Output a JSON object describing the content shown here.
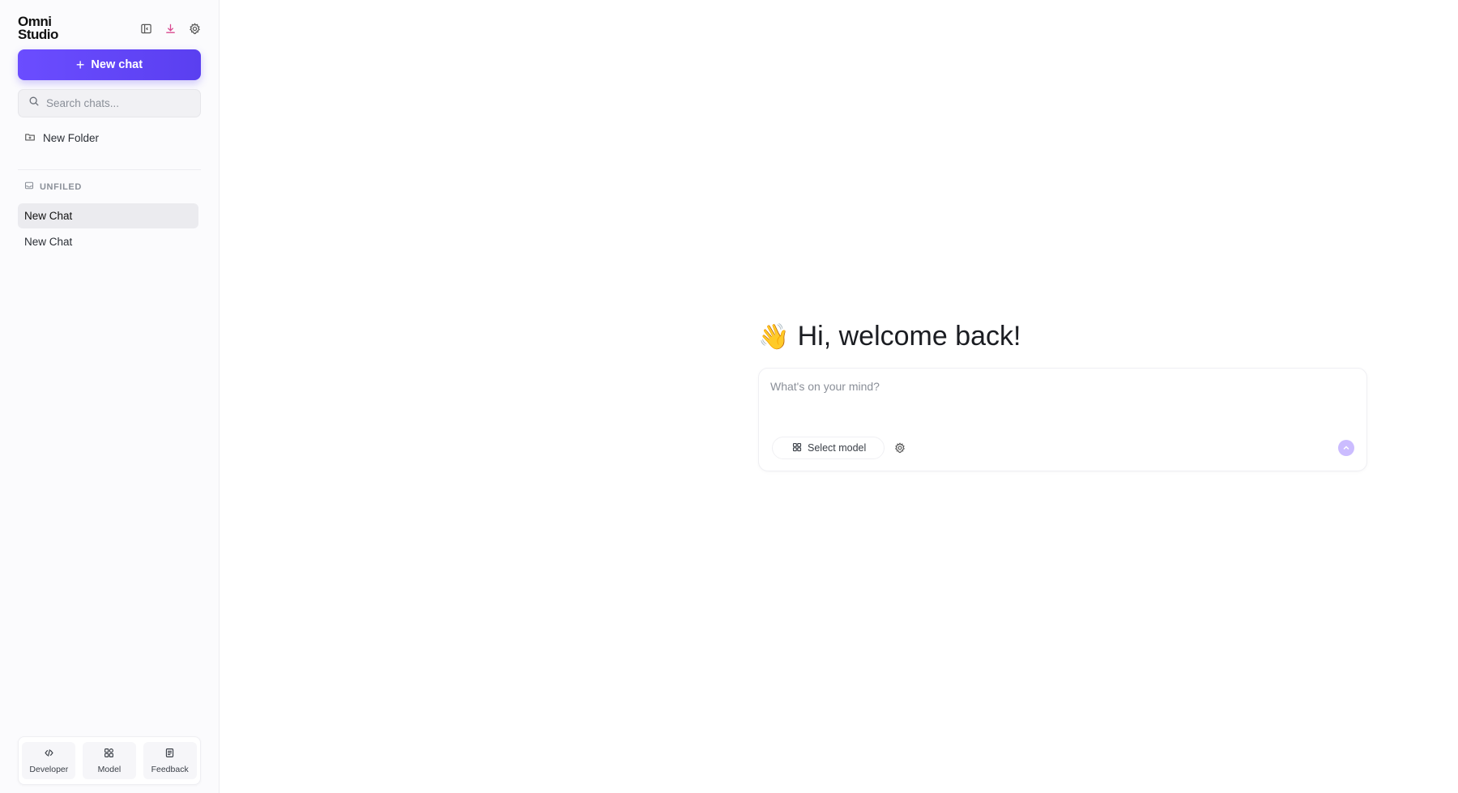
{
  "sidebar": {
    "logo_line1": "Omni",
    "logo_line2": "Studio",
    "header_icons": [
      "sidebar-toggle-icon",
      "download-icon",
      "gear-icon"
    ],
    "new_chat_label": "New chat",
    "search_placeholder": "Search chats...",
    "new_folder_label": "New Folder",
    "section_label": "UNFILED",
    "chats": [
      {
        "label": "New Chat",
        "active": true
      },
      {
        "label": "New Chat",
        "active": false
      }
    ],
    "bottom_buttons": [
      {
        "label": "Developer",
        "icon": "code-icon"
      },
      {
        "label": "Model",
        "icon": "grid-icon"
      },
      {
        "label": "Feedback",
        "icon": "document-icon"
      }
    ]
  },
  "main": {
    "welcome_emoji": "👋",
    "welcome_text": "Hi, welcome back!",
    "composer_placeholder": "What's on your mind?",
    "select_model_label": "Select model"
  },
  "colors": {
    "accent": "#5a3ff0",
    "download_icon": "#d9488f",
    "send_button": "#cbbcff"
  }
}
